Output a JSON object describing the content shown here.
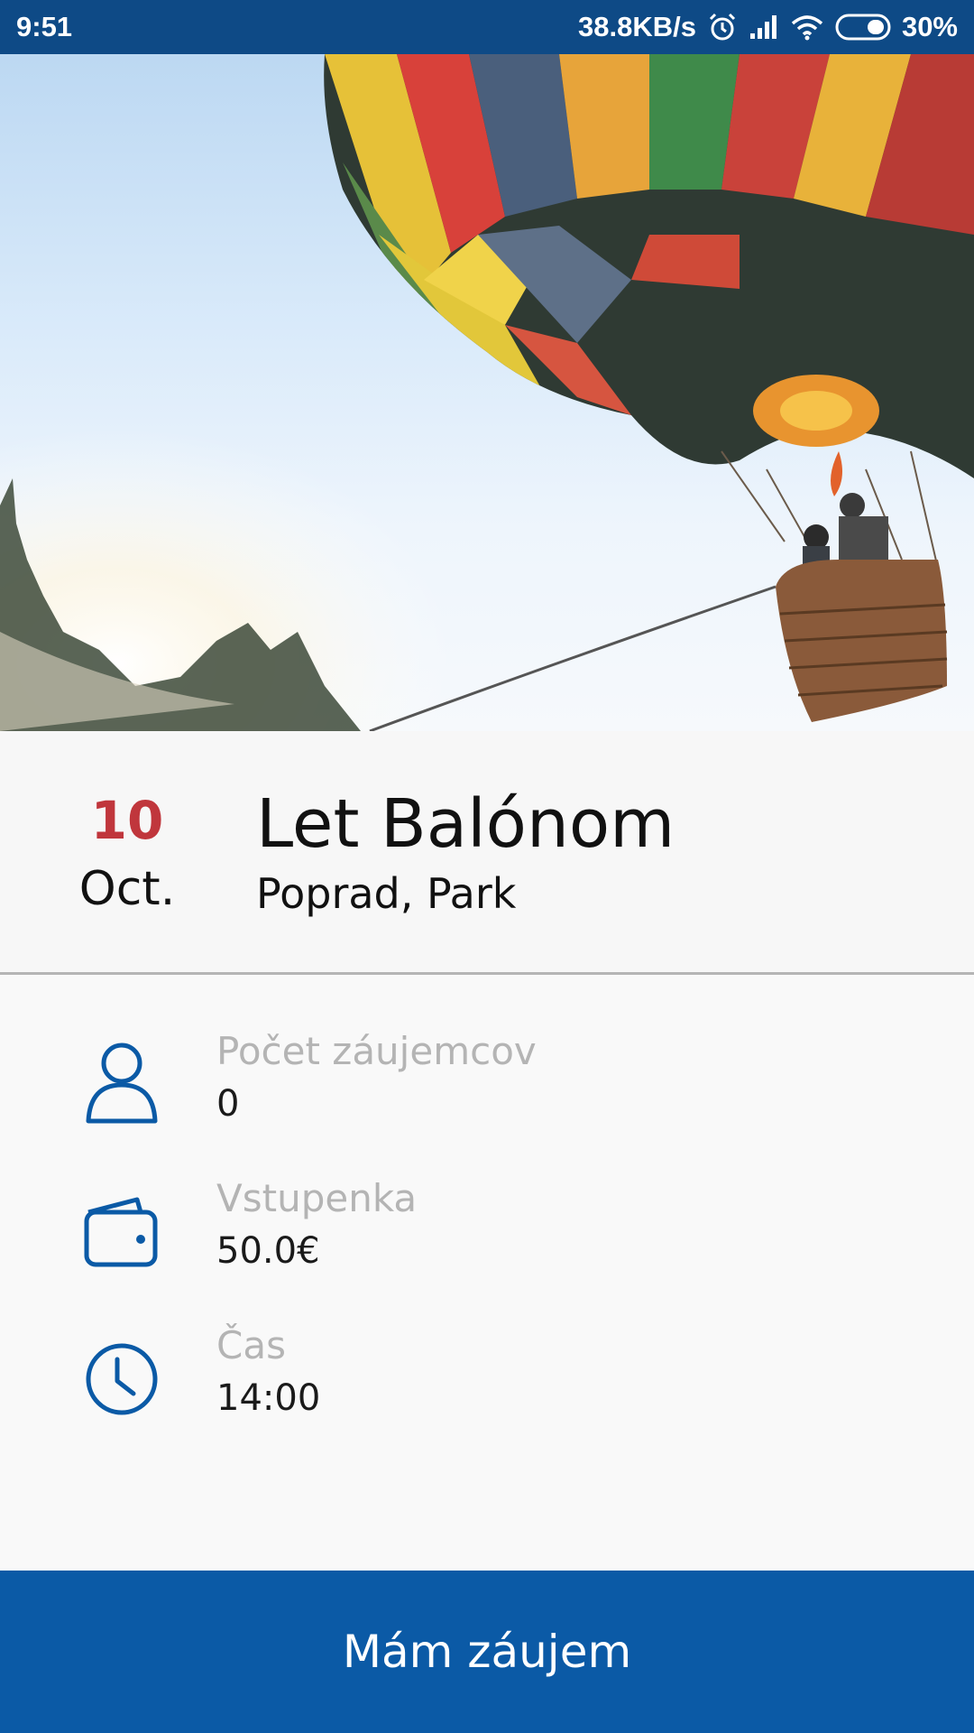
{
  "status_bar": {
    "time": "9:51",
    "network_speed": "38.8KB/s",
    "battery_percent": "30%",
    "icons": [
      "alarm-icon",
      "signal-icon",
      "wifi-icon",
      "battery-icon"
    ]
  },
  "hero": {
    "image": "hot-air-balloon-photo"
  },
  "event": {
    "day": "10",
    "month": "Oct.",
    "title": "Let Balónom",
    "location": "Poprad, Park"
  },
  "details": [
    {
      "icon": "person-icon",
      "label": "Počet záujemcov",
      "value": "0"
    },
    {
      "icon": "wallet-icon",
      "label": "Vstupenka",
      "value": "50.0€"
    },
    {
      "icon": "clock-icon",
      "label": "Čas",
      "value": "14:00"
    }
  ],
  "cta": {
    "label": "Mám záujem"
  },
  "colors": {
    "status_bar": "#0e4a86",
    "accent_blue": "#0b5aa6",
    "date_red": "#c0363c",
    "label_gray": "#b4b4b4"
  }
}
